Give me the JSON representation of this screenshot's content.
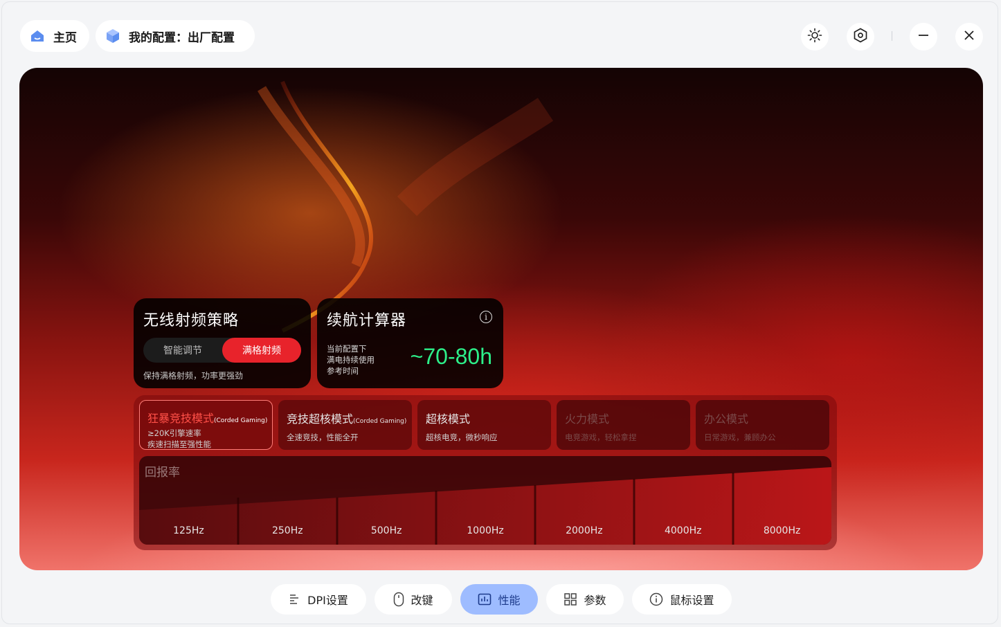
{
  "topbar": {
    "home_label": "主页",
    "config_label": "我的配置：出厂配置"
  },
  "icons": {
    "brightness": "sun-icon",
    "settings": "hex-settings-icon",
    "minimize": "minimize-icon",
    "close": "close-icon"
  },
  "radio_card": {
    "title": "无线射频策略",
    "options": [
      "智能调节",
      "满格射频"
    ],
    "selected": "满格射频",
    "note": "保持满格射频，功率更强劲"
  },
  "battery_card": {
    "title": "续航计算器",
    "line1": "当前配置下",
    "line2": "满电持续使用",
    "line3": "参考时间",
    "value": "~70-80h"
  },
  "modes": [
    {
      "title": "狂暴竞技模式",
      "tag": "(Corded Gaming)",
      "line1": "≥20K引擎速率",
      "line2": "疾速扫描至强性能"
    },
    {
      "title": "竞技超核模式",
      "tag": "(Corded Gaming)",
      "sub": "全速竞技，性能全开"
    },
    {
      "title": "超核模式",
      "sub": "超核电竞，微秒响应"
    },
    {
      "title": "火力模式",
      "sub": "电竞游戏，轻松拿捏"
    },
    {
      "title": "办公模式",
      "sub": "日常游戏，兼顾办公"
    }
  ],
  "polling": {
    "title": "回报率",
    "rates": [
      "125Hz",
      "250Hz",
      "500Hz",
      "1000Hz",
      "2000Hz",
      "4000Hz",
      "8000Hz"
    ]
  },
  "bottom_nav": [
    {
      "label": "DPI设置",
      "icon": "dpi-icon"
    },
    {
      "label": "改键",
      "icon": "mouse-icon"
    },
    {
      "label": "性能",
      "icon": "performance-icon",
      "active": true
    },
    {
      "label": "参数",
      "icon": "params-grid-icon"
    },
    {
      "label": "鼠标设置",
      "icon": "info-icon"
    }
  ],
  "colors": {
    "accent_red": "#e8232b",
    "battery_green": "#2df08a",
    "nav_active": "#9ebcff"
  }
}
